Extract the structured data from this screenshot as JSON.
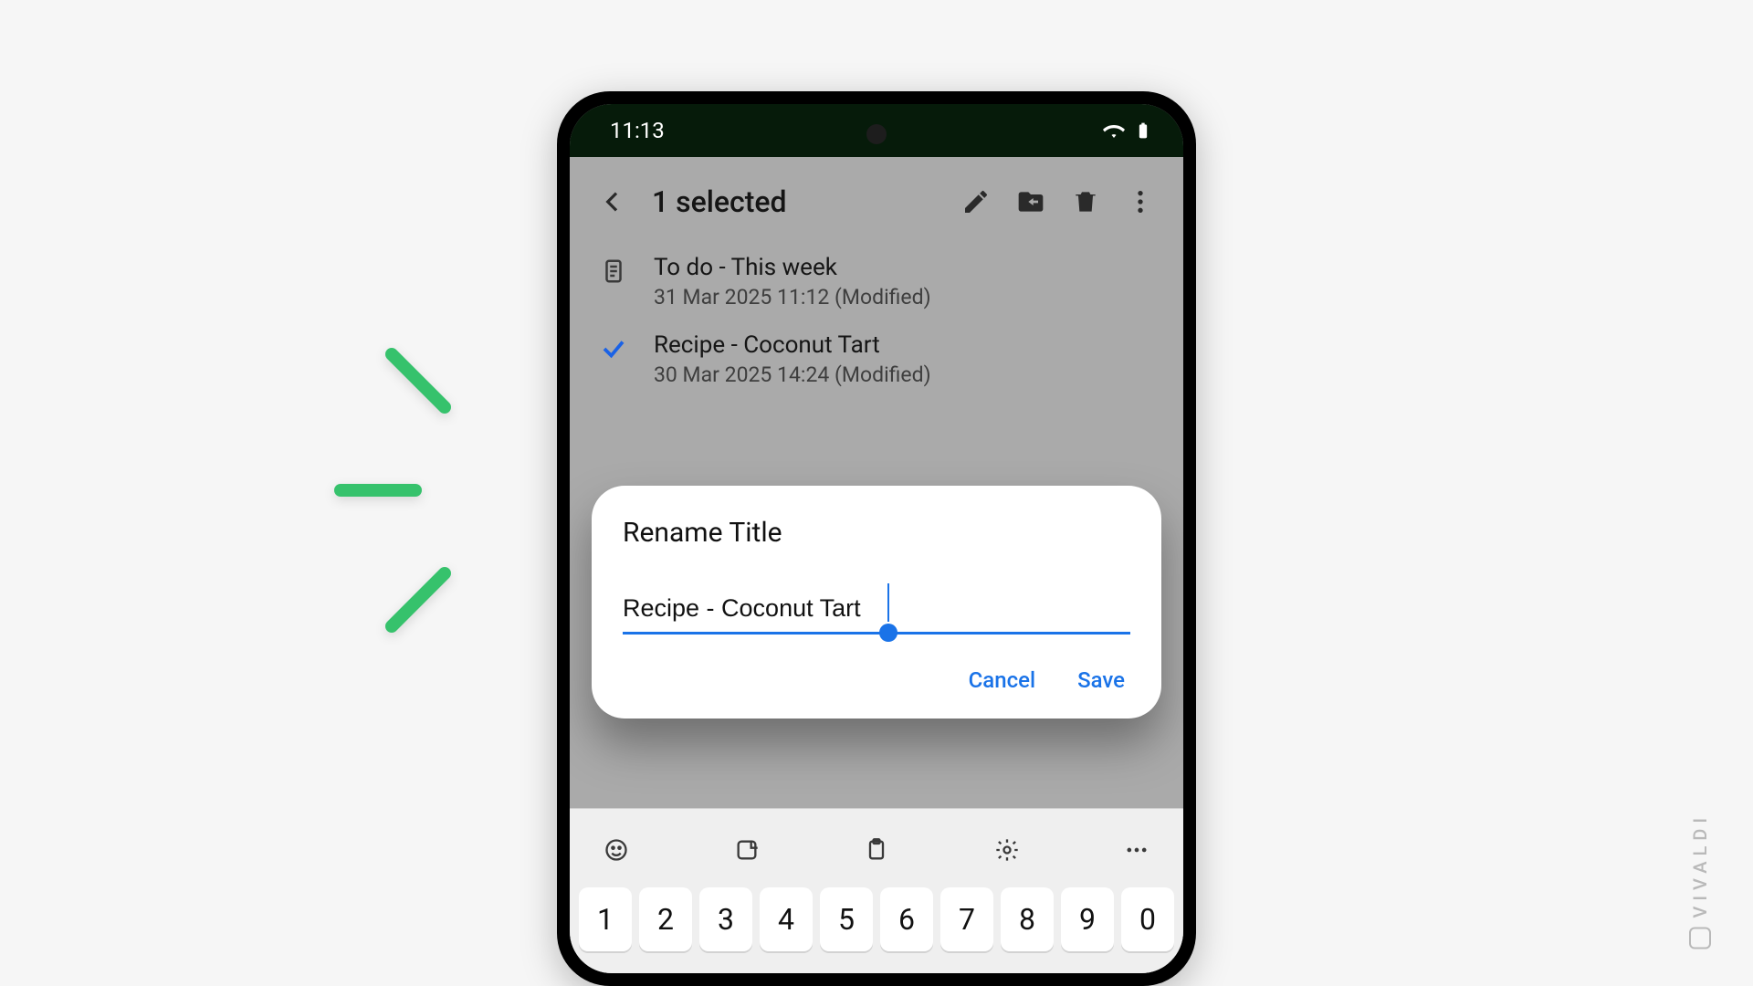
{
  "brand": "VIVALDI",
  "accent_color": "#36c26c",
  "primary_color": "#1a73e8",
  "status": {
    "time": "11:13"
  },
  "toolbar": {
    "selection_label": "1 selected"
  },
  "notes": [
    {
      "title": "To do - This week",
      "meta": "31 Mar 2025 11:12 (Modified)",
      "selected": false
    },
    {
      "title": "Recipe - Coconut Tart",
      "meta": "30 Mar 2025 14:24 (Modified)",
      "selected": true
    }
  ],
  "dialog": {
    "heading": "Rename Title",
    "input_value": "Recipe - Coconut Tart",
    "cancel_label": "Cancel",
    "save_label": "Save"
  },
  "keyboard": {
    "tool_icons": [
      "emoji-icon",
      "sticker-icon",
      "clipboard-icon",
      "settings-icon",
      "more-icon"
    ],
    "row_digits": [
      "1",
      "2",
      "3",
      "4",
      "5",
      "6",
      "7",
      "8",
      "9",
      "0"
    ]
  }
}
